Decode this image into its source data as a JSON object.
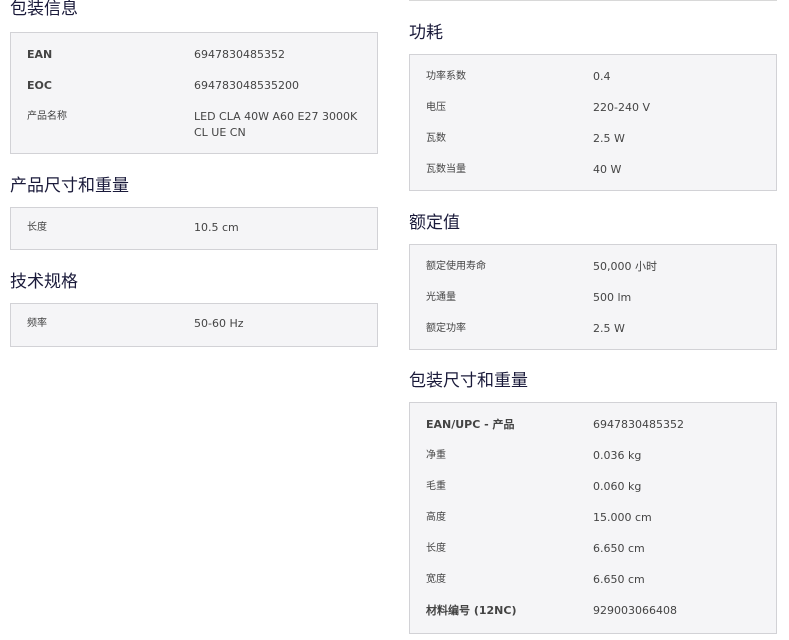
{
  "left": [
    {
      "title": "包装信息",
      "rows": [
        {
          "key": "EAN",
          "value": "6947830485352",
          "bold": true
        },
        {
          "key": "EOC",
          "value": "694783048535200",
          "bold": true
        },
        {
          "key": "产品名称",
          "value": "LED CLA 40W A60 E27 3000K CL UE CN",
          "bold": false
        }
      ]
    },
    {
      "title": "产品尺寸和重量",
      "rows": [
        {
          "key": "长度",
          "value": "10.5  cm",
          "bold": false
        }
      ]
    },
    {
      "title": "技术规格",
      "rows": [
        {
          "key": "频率",
          "value": "50-60  Hz",
          "bold": false
        }
      ]
    }
  ],
  "right": [
    {
      "title": "功耗",
      "rows": [
        {
          "key": "功率系数",
          "value": "0.4",
          "bold": false
        },
        {
          "key": "电压",
          "value": "220-240  V",
          "bold": false
        },
        {
          "key": "瓦数",
          "value": "2.5  W",
          "bold": false
        },
        {
          "key": "瓦数当量",
          "value": "40  W",
          "bold": false
        }
      ]
    },
    {
      "title": "额定值",
      "rows": [
        {
          "key": "额定使用寿命",
          "value": "50,000  小时",
          "bold": false
        },
        {
          "key": "光通量",
          "value": "500  lm",
          "bold": false
        },
        {
          "key": "额定功率",
          "value": "2.5  W",
          "bold": false
        }
      ]
    },
    {
      "title": "包装尺寸和重量",
      "rows": [
        {
          "key": "EAN/UPC - 产品",
          "value": "6947830485352",
          "bold": true
        },
        {
          "key": "净重",
          "value": "0.036  kg",
          "bold": false
        },
        {
          "key": "毛重",
          "value": "0.060  kg",
          "bold": false
        },
        {
          "key": "高度",
          "value": "15.000  cm",
          "bold": false
        },
        {
          "key": "长度",
          "value": "6.650  cm",
          "bold": false
        },
        {
          "key": "宽度",
          "value": "6.650  cm",
          "bold": false
        },
        {
          "key": "材料编号 (12NC)",
          "value": "929003066408",
          "bold": true
        }
      ]
    }
  ]
}
